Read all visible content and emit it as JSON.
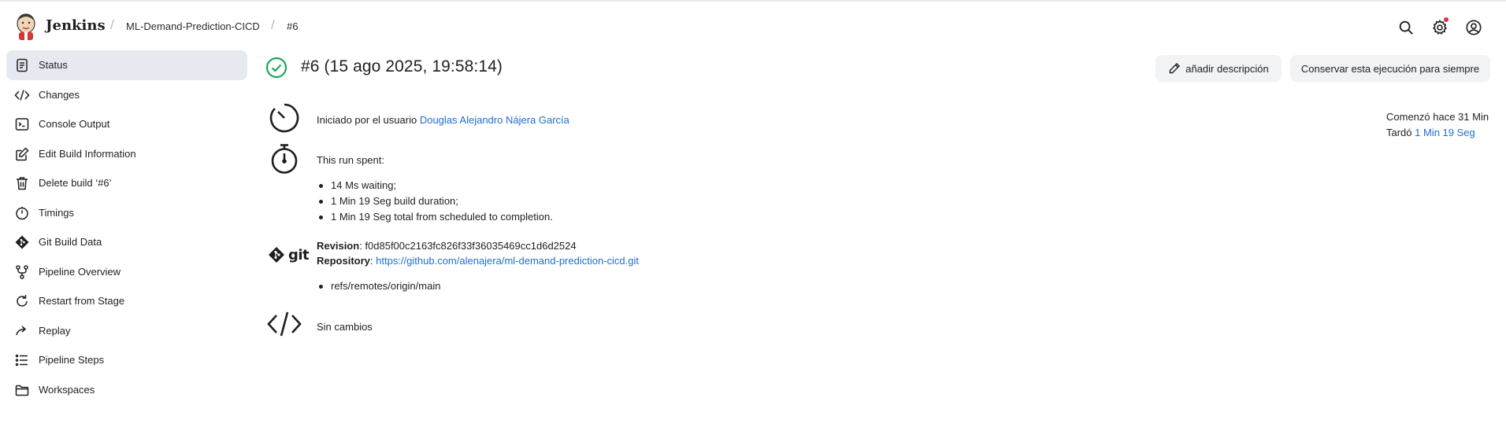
{
  "header": {
    "brand": "Jenkins",
    "breadcrumbs": [
      "ML-Demand-Prediction-CICD",
      "#6"
    ],
    "icons": [
      "search-icon",
      "gear-icon",
      "user-icon"
    ]
  },
  "sidebar": {
    "items": [
      {
        "label": "Status",
        "icon": "document-icon",
        "active": true
      },
      {
        "label": "Changes",
        "icon": "code-icon"
      },
      {
        "label": "Console Output",
        "icon": "terminal-icon"
      },
      {
        "label": "Edit Build Information",
        "icon": "edit-icon"
      },
      {
        "label": "Delete build ‘#6’",
        "icon": "trash-icon"
      },
      {
        "label": "Timings",
        "icon": "stopwatch-icon"
      },
      {
        "label": "Git Build Data",
        "icon": "git-icon"
      },
      {
        "label": "Pipeline Overview",
        "icon": "branch-icon"
      },
      {
        "label": "Restart from Stage",
        "icon": "restart-icon"
      },
      {
        "label": "Replay",
        "icon": "replay-icon"
      },
      {
        "label": "Pipeline Steps",
        "icon": "list-icon"
      },
      {
        "label": "Workspaces",
        "icon": "folder-icon"
      }
    ]
  },
  "build": {
    "title": "#6 (15 ago 2025, 19:58:14)",
    "status": "success",
    "add_description_label": "añadir descripción",
    "keep_forever_label": "Conservar esta ejecución para siempre",
    "started_by_prefix": "Iniciado por el usuario",
    "started_by_user": "Douglas Alejandro Nájera García",
    "run_spent_label": "This run spent:",
    "run_spent_items": [
      "14 Ms waiting;",
      "1 Min 19 Seg build duration;",
      "1 Min 19 Seg total from scheduled to completion."
    ],
    "revision_label": "Revision",
    "revision_value": ": f0d85f00c2163fc826f33f36035469cc1d6d2524",
    "repository_label": "Repository",
    "repository_sep": ": ",
    "repository_url": "https://github.com/alenajera/ml-demand-prediction-cicd.git",
    "refs": [
      "refs/remotes/origin/main"
    ],
    "git_word": "git",
    "no_changes": "Sin cambios",
    "started_ago": "Comenzó hace 31 Min",
    "took_label": "Tardó",
    "took_value": "1 Min 19 Seg"
  },
  "colors": {
    "accent_link": "#1e6fd0",
    "success": "#1ea55a",
    "active_bg": "#e6eaf0",
    "notification_dot": "#e0304a"
  }
}
